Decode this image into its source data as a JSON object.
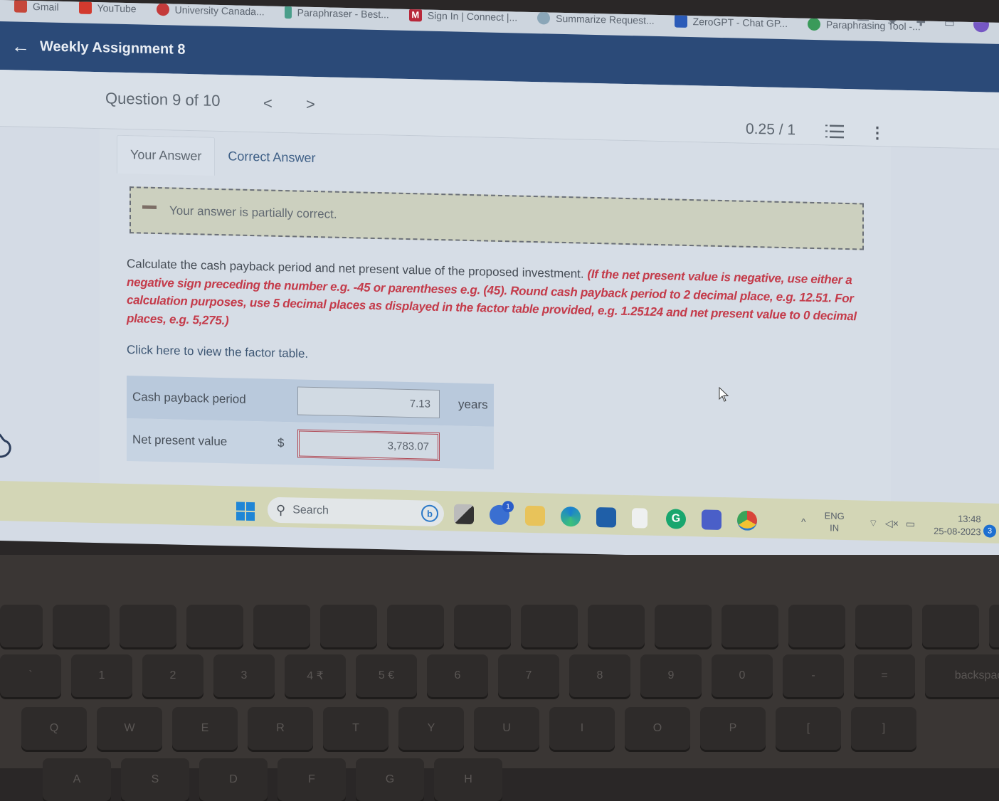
{
  "browser": {
    "bookmarks": [
      {
        "label": "Gmail",
        "icon": "gmail-icon",
        "color": "#c5473a"
      },
      {
        "label": "YouTube",
        "icon": "youtube-icon",
        "color": "#d23a2e"
      },
      {
        "label": "University Canada...",
        "icon": "university-icon",
        "color": "#c43a3a"
      },
      {
        "label": "Paraphraser - Best...",
        "icon": "paraphraser-icon",
        "color": "#4a9e8a"
      },
      {
        "label": "Sign In | Connect |...",
        "icon": "mcgraw-icon",
        "color": "#b8283a"
      },
      {
        "label": "Summarize Request...",
        "icon": "summarize-icon",
        "color": "#8aa6b8"
      },
      {
        "label": "ZeroGPT - Chat GP...",
        "icon": "zerogpt-icon",
        "color": "#2b5bb8"
      },
      {
        "label": "Paraphrasing Tool -...",
        "icon": "paraphrasing-tool-icon",
        "color": "#3a9a5a"
      }
    ]
  },
  "header": {
    "title": "Weekly Assignment 8"
  },
  "question_nav": {
    "label": "Question 9 of 10",
    "prev": "<",
    "next": ">",
    "score": "0.25 / 1"
  },
  "tabs": [
    {
      "label": "Your Answer",
      "active": true
    },
    {
      "label": "Correct Answer",
      "active": false
    }
  ],
  "feedback": {
    "text": "Your answer is partially correct."
  },
  "question": {
    "prompt": "Calculate the cash payback period and net present value of the proposed investment. ",
    "instructions": "(If the net present value is negative, use either a negative sign preceding the number e.g. -45 or parentheses e.g. (45). Round cash payback period to 2 decimal place, e.g. 12.51. For calculation purposes, use 5 decimal places as displayed in the factor table provided, e.g. 1.25124 and net present value to 0 decimal places, e.g. 5,275.)",
    "factor_link": "Click here to view the factor table."
  },
  "answers": [
    {
      "label": "Cash payback period",
      "prefix": "",
      "value": "7.13",
      "unit": "years",
      "status": "correct"
    },
    {
      "label": "Net present value",
      "prefix": "$",
      "value": "3,783.07",
      "unit": "",
      "status": "incorrect"
    }
  ],
  "taskbar": {
    "search_placeholder": "Search",
    "apps": [
      {
        "name": "task-view",
        "badge": ""
      },
      {
        "name": "teams-chat",
        "badge": "1"
      },
      {
        "name": "file-explorer",
        "badge": ""
      },
      {
        "name": "edge",
        "badge": ""
      },
      {
        "name": "microsoft-store",
        "badge": ""
      },
      {
        "name": "notepad",
        "badge": ""
      },
      {
        "name": "grammarly",
        "badge": ""
      },
      {
        "name": "teams",
        "badge": ""
      },
      {
        "name": "chrome",
        "badge": ""
      }
    ],
    "language_line1": "ENG",
    "language_line2": "IN",
    "time": "13:48",
    "date": "25-08-2023",
    "notifications": "3"
  },
  "keyboard": {
    "row_numbers": [
      "1",
      "2",
      "3",
      "4 ₹",
      "5 €",
      "6",
      "7",
      "8",
      "9",
      "0",
      "-",
      "=",
      "backspace"
    ],
    "row_top": [
      "Q",
      "W",
      "E",
      "R",
      "T",
      "Y",
      "U",
      "I",
      "O",
      "P",
      "[",
      "]"
    ],
    "row_home": [
      "A",
      "S",
      "D",
      "F",
      "G",
      "H"
    ]
  }
}
